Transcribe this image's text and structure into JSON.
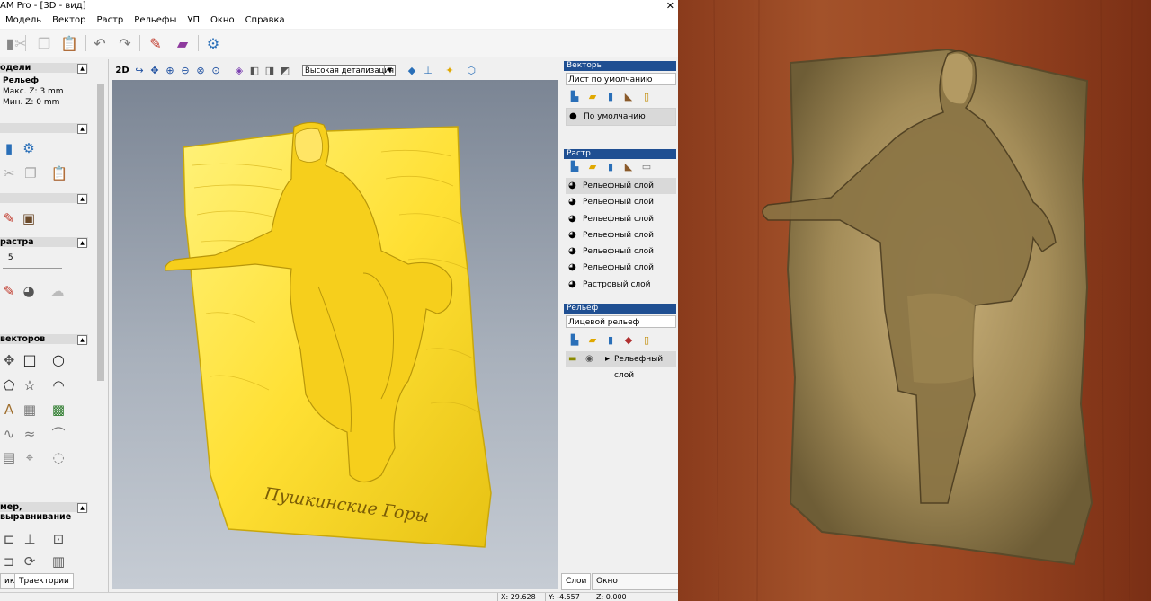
{
  "window": {
    "title": "AM Pro - [3D - вид]",
    "close_glyph": "✕"
  },
  "menu": [
    "Модель",
    "Вектор",
    "Растр",
    "Рельефы",
    "УП",
    "Окно",
    "Справка"
  ],
  "left_panel": {
    "model_header": "одели",
    "relief_name": "Рельеф",
    "max_z": "Макс. Z: 3 mm",
    "min_z": "Мин. Z: 0 mm",
    "raster_header": "растра",
    "raster_value": ": 5",
    "vectors_header": "векторов",
    "align_header": "мер, выравнивание",
    "tabs": [
      "ик",
      "Траектории"
    ]
  },
  "view_toolbar": {
    "mode_2d": "2D",
    "detail_level": "Высокая детализация"
  },
  "relief_text": "Пушкинские Горы",
  "right_panel": {
    "vectors": {
      "header": "Векторы",
      "sheet": "Лист по умолчанию",
      "layers": [
        "По умолчанию"
      ]
    },
    "raster": {
      "header": "Растр",
      "layers": [
        "Рельефный слой",
        "Рельефный слой",
        "Рельефный слой",
        "Рельефный слой",
        "Рельефный слой",
        "Рельефный слой",
        "Растровый слой"
      ]
    },
    "relief": {
      "header": "Рельеф",
      "name": "Лицевой рельеф",
      "layer": "Рельефный слой"
    },
    "tabs": [
      "Слои",
      "Окно инструментари"
    ]
  },
  "status": {
    "x": "X: 29.628",
    "y": "Y: -4.557",
    "z": "Z: 0.000"
  },
  "colors": {
    "accent": "#1f4f92",
    "relief_yellow": "#ffe34a",
    "bronze": "#b89b5d"
  }
}
